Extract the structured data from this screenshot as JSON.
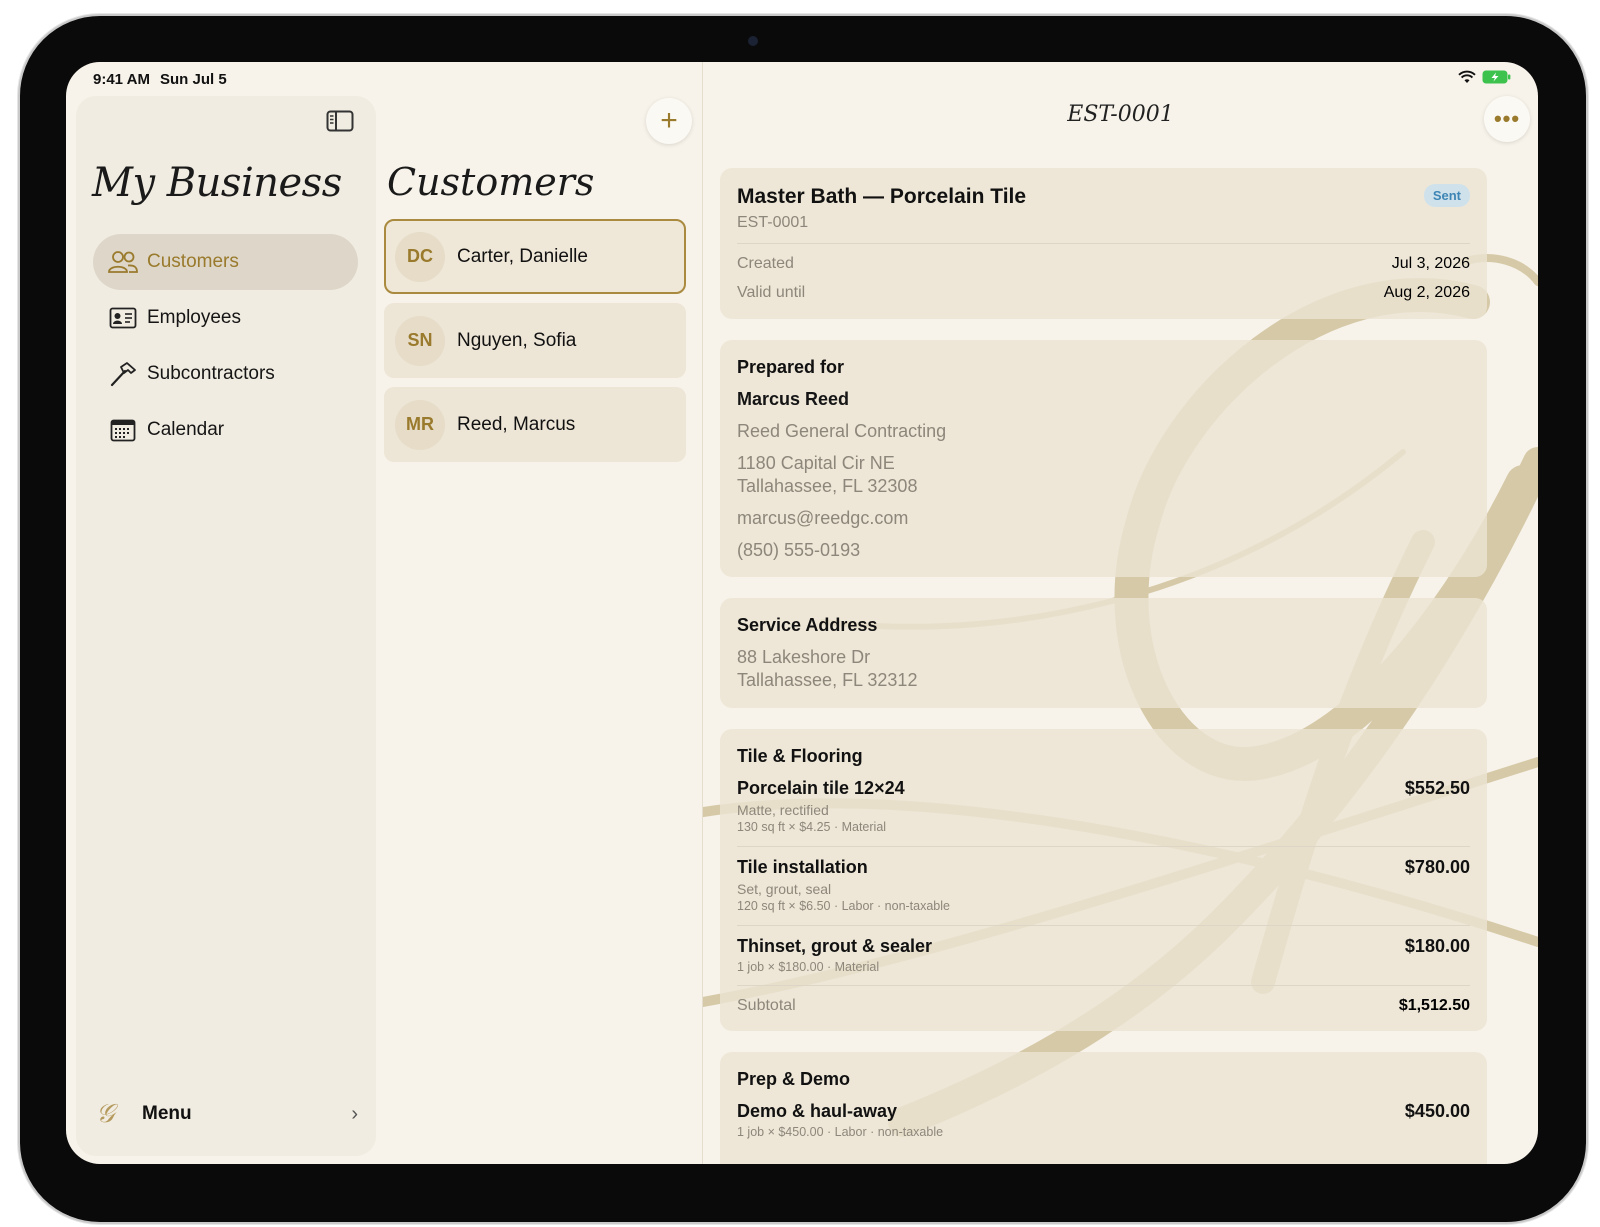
{
  "status_bar": {
    "time": "9:41 AM",
    "date": "Sun Jul 5"
  },
  "sidebar": {
    "brand": "My Business",
    "items": [
      {
        "label": "Customers",
        "icon": "people-icon",
        "active": true
      },
      {
        "label": "Employees",
        "icon": "id-card-icon",
        "active": false
      },
      {
        "label": "Subcontractors",
        "icon": "hammer-icon",
        "active": false
      },
      {
        "label": "Calendar",
        "icon": "calendar-icon",
        "active": false
      }
    ],
    "menu_label": "Menu"
  },
  "customers": {
    "title": "Customers",
    "list": [
      {
        "initials": "DC",
        "name": "Carter, Danielle"
      },
      {
        "initials": "SN",
        "name": "Nguyen, Sofia"
      },
      {
        "initials": "MR",
        "name": "Reed, Marcus"
      }
    ]
  },
  "estimate": {
    "nav_title": "EST-0001",
    "title": "Master Bath — Porcelain Tile",
    "number": "EST-0001",
    "status": "Sent",
    "created_label": "Created",
    "created_value": "Jul 3, 2026",
    "valid_label": "Valid until",
    "valid_value": "Aug 2, 2026",
    "prepared_for": {
      "heading": "Prepared for",
      "name": "Marcus Reed",
      "company": "Reed General Contracting",
      "address_line1": "1180 Capital Cir NE",
      "address_line2": "Tallahassee, FL 32308",
      "email": "marcus@reedgc.com",
      "phone": "(850) 555-0193"
    },
    "service_address": {
      "heading": "Service Address",
      "line1": "88 Lakeshore Dr",
      "line2": "Tallahassee, FL 32312"
    },
    "sections": [
      {
        "heading": "Tile & Flooring",
        "items": [
          {
            "name": "Porcelain tile 12×24",
            "desc": "Matte, rectified",
            "meta": "130 sq ft × $4.25  ·  Material",
            "price": "$552.50"
          },
          {
            "name": "Tile installation",
            "desc": "Set, grout, seal",
            "meta": "120 sq ft × $6.50  ·  Labor  · non-taxable",
            "price": "$780.00"
          },
          {
            "name": "Thinset, grout & sealer",
            "desc": "",
            "meta": "1 job × $180.00  ·  Material",
            "price": "$180.00"
          }
        ],
        "subtotal_label": "Subtotal",
        "subtotal": "$1,512.50"
      },
      {
        "heading": "Prep & Demo",
        "items": [
          {
            "name": "Demo & haul-away",
            "desc": "",
            "meta": "1 job × $450.00  ·  Labor  · non-taxable",
            "price": "$450.00"
          }
        ]
      }
    ]
  },
  "colors": {
    "accent": "#9a7a2c",
    "background": "#f7f3ea",
    "card": "#ece4d3",
    "badge_bg": "#cfe2ec",
    "badge_text": "#3f86b5"
  }
}
